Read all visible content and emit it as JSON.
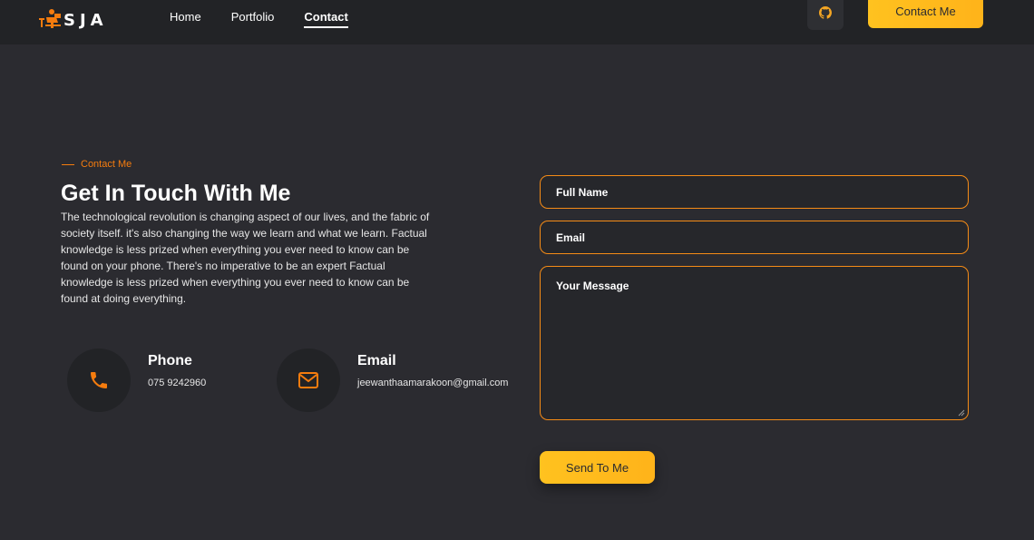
{
  "header": {
    "logo_text": "SJA",
    "nav": [
      {
        "label": "Home",
        "active": false
      },
      {
        "label": "Portfolio",
        "active": false
      },
      {
        "label": "Contact",
        "active": true
      }
    ],
    "github_icon": "github-icon",
    "contact_button": "Contact Me"
  },
  "contact": {
    "eyebrow": "Contact Me",
    "title": "Get In Touch With Me",
    "description": "The technological revolution is changing aspect of our lives, and the fabric of society itself. it's also changing the way we learn and what we learn. Factual knowledge is less prized when everything you ever need to know can be found on your phone. There's no imperative to be an expert Factual knowledge is less prized when everything you ever need to know can be found at doing everything.",
    "phone": {
      "label": "Phone",
      "value": "075 9242960",
      "icon": "phone-icon"
    },
    "email": {
      "label": "Email",
      "value": "jeewanthaamarakoon@gmail.com",
      "icon": "mail-icon"
    }
  },
  "form": {
    "full_name_placeholder": "Full Name",
    "email_placeholder": "Email",
    "message_placeholder": "Your Message",
    "submit_label": "Send To Me"
  },
  "colors": {
    "background": "#2b2b30",
    "header": "#222326",
    "accent_orange": "#f57c0e",
    "accent_yellow": "#ffc21f"
  }
}
